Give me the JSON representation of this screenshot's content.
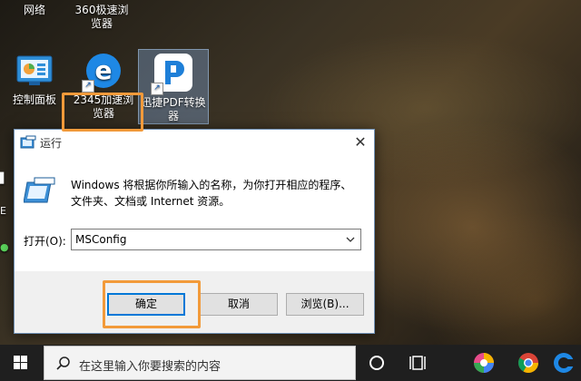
{
  "desktop": {
    "icons": [
      {
        "label": "网络",
        "icon": "network-icon"
      },
      {
        "label": "360极速浏览器",
        "icon": "360-browser-icon"
      },
      {
        "label": "控制面板",
        "icon": "control-panel-icon"
      },
      {
        "label": "2345加速浏览器",
        "icon": "ie-browser-icon"
      },
      {
        "label": "迅捷PDF转换器",
        "icon": "pdf-converter-icon"
      }
    ]
  },
  "dialog": {
    "title": "运行",
    "description": "Windows 将根据你所输入的名称，为你打开相应的程序、文件夹、文档或 Internet 资源。",
    "open_label": "打开(O):",
    "input_value": "MSConfig",
    "buttons": {
      "ok": "确定",
      "cancel": "取消",
      "browse": "浏览(B)..."
    },
    "highlight_color": "#f29a3a"
  },
  "taskbar": {
    "search_placeholder": "在这里输入你要搜索的内容",
    "icons": [
      "windows-start-icon",
      "search-icon",
      "cortana-icon",
      "task-view-icon",
      "colorful-app-icon",
      "chrome-icon",
      "blue-app-icon"
    ]
  }
}
